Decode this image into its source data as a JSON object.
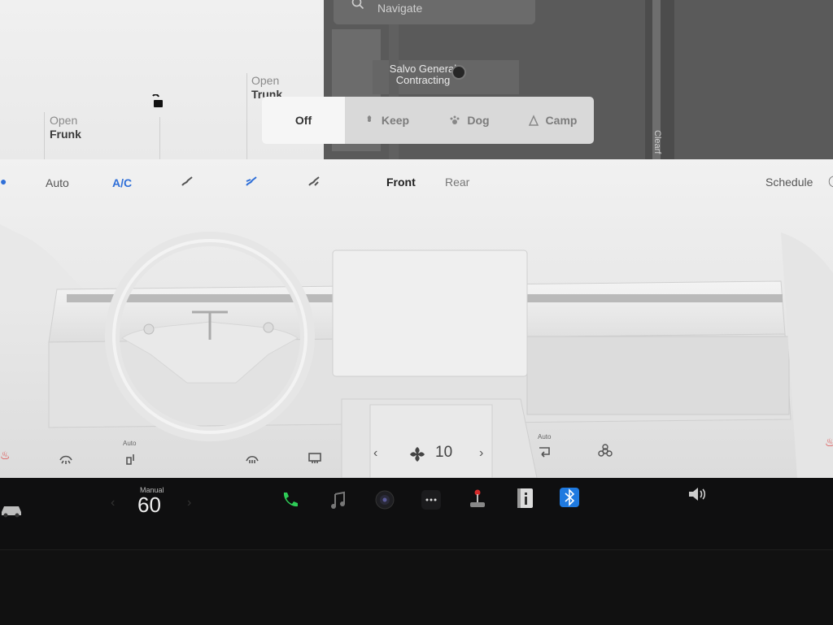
{
  "car_panel": {
    "frunk": {
      "line1": "Open",
      "line2": "Frunk"
    },
    "trunk": {
      "line1": "Open",
      "line2": "Trunk"
    }
  },
  "map": {
    "search_placeholder": "Navigate",
    "poi_name_line1": "Salvo General",
    "poi_name_line2": "Contracting",
    "street_label": "Clearf"
  },
  "modes": [
    {
      "label": "Off",
      "icon": "power-off",
      "active": true
    },
    {
      "label": "Keep",
      "icon": "fan-icon"
    },
    {
      "label": "Dog",
      "icon": "paw-icon"
    },
    {
      "label": "Camp",
      "icon": "tent-icon"
    }
  ],
  "climate": {
    "auto_label": "Auto",
    "ac_label": "A/C",
    "front_label": "Front",
    "rear_label": "Rear",
    "schedule_label": "Schedule",
    "fan_speed": "10",
    "auto_small_left": "Auto",
    "auto_small_right": "Auto"
  },
  "taskbar": {
    "speed_mode": "Manual",
    "speed_value": "60",
    "icons": [
      "car-icon",
      "phone-icon",
      "music-icon",
      "camera-icon",
      "more-icon",
      "joystick-icon",
      "info-icon",
      "bluetooth-icon",
      "volume-icon"
    ]
  },
  "colors": {
    "accent_blue": "#2f6fd8",
    "phone_green": "#2ecc57",
    "bluetooth_blue": "#1f7ae0"
  }
}
